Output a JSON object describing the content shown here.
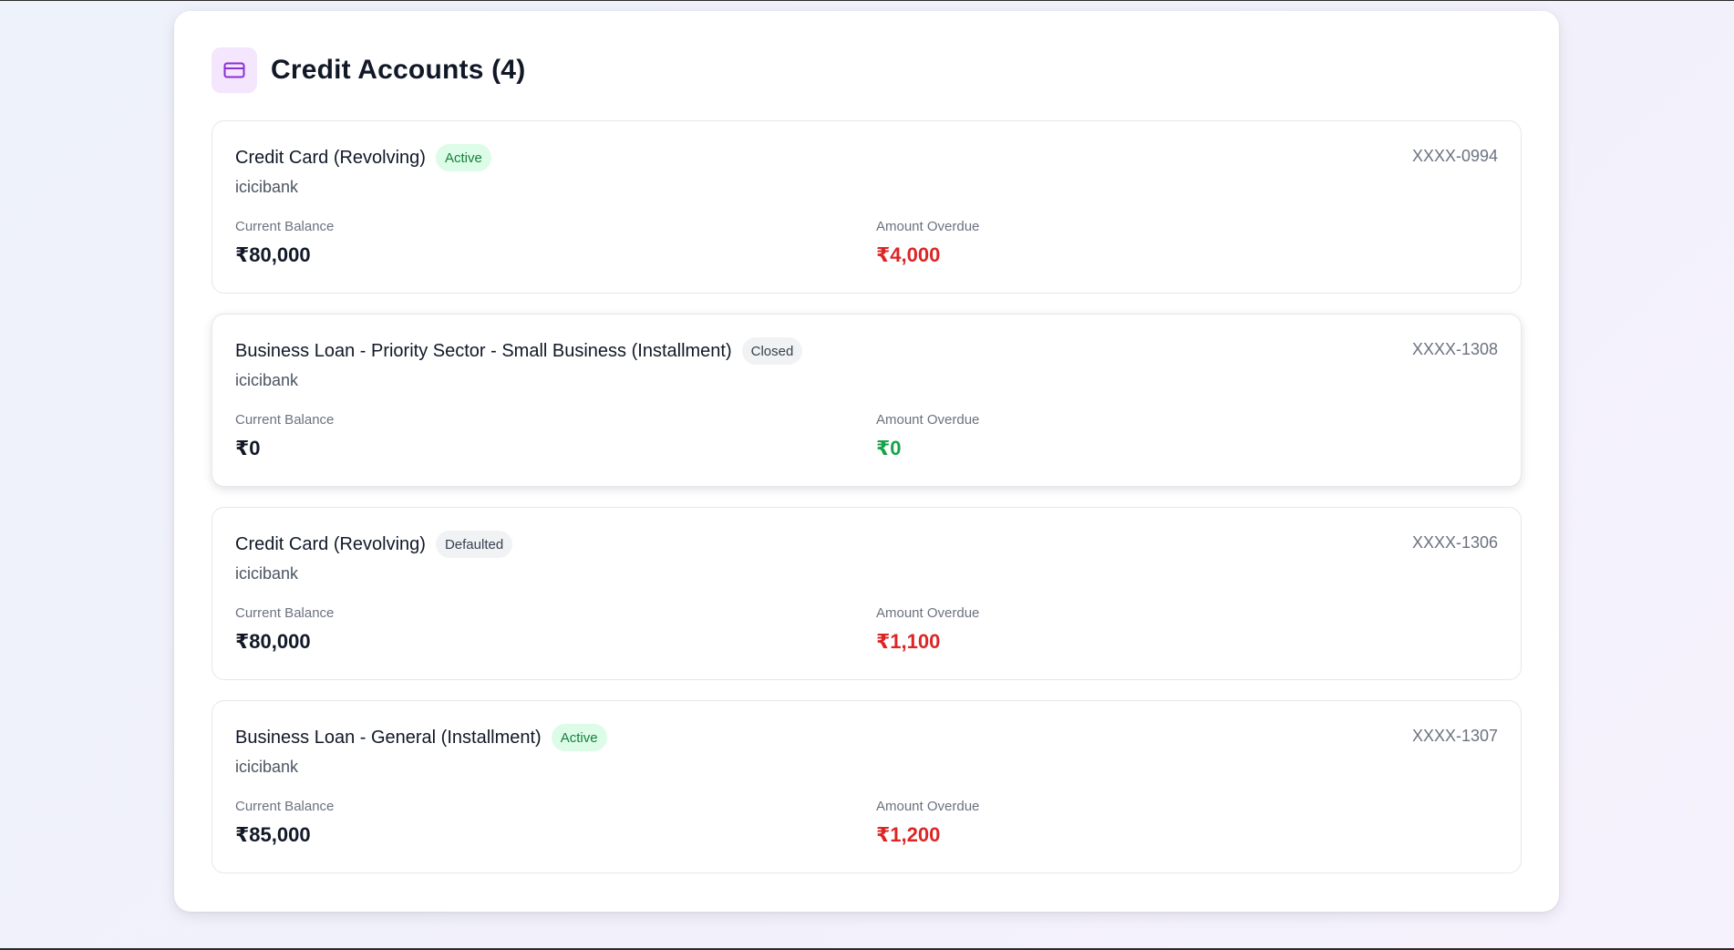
{
  "section": {
    "title": "Credit Accounts (4)",
    "icon": "credit-card-icon"
  },
  "colors": {
    "overdue_positive": "#dc2626",
    "overdue_zero": "#16a34a",
    "badge_active_bg": "#dcfce7",
    "badge_active_text": "#15803d"
  },
  "accounts": [
    {
      "title": "Credit Card (Revolving)",
      "status": "Active",
      "bank": "icicibank",
      "number": "XXXX-0994",
      "current_balance_label": "Current Balance",
      "current_balance": "₹80,000",
      "amount_overdue_label": "Amount Overdue",
      "amount_overdue": "₹4,000"
    },
    {
      "title": "Business Loan - Priority Sector - Small Business (Installment)",
      "status": "Closed",
      "bank": "icicibank",
      "number": "XXXX-1308",
      "current_balance_label": "Current Balance",
      "current_balance": "₹0",
      "amount_overdue_label": "Amount Overdue",
      "amount_overdue": "₹0"
    },
    {
      "title": "Credit Card (Revolving)",
      "status": "Defaulted",
      "bank": "icicibank",
      "number": "XXXX-1306",
      "current_balance_label": "Current Balance",
      "current_balance": "₹80,000",
      "amount_overdue_label": "Amount Overdue",
      "amount_overdue": "₹1,100"
    },
    {
      "title": "Business Loan - General (Installment)",
      "status": "Active",
      "bank": "icicibank",
      "number": "XXXX-1307",
      "current_balance_label": "Current Balance",
      "current_balance": "₹85,000",
      "amount_overdue_label": "Amount Overdue",
      "amount_overdue": "₹1,200"
    }
  ]
}
